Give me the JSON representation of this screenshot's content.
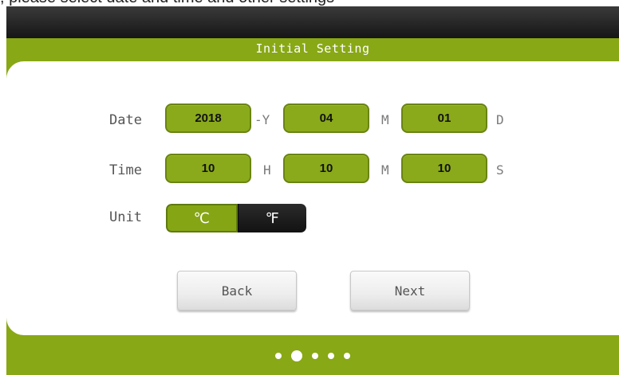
{
  "header": {
    "caption": ", please select date and time and other settings",
    "title": "Initial Setting"
  },
  "form": {
    "date": {
      "label": "Date",
      "year": {
        "value": "2018",
        "unit": "-Y"
      },
      "month": {
        "value": "04",
        "unit": "M"
      },
      "day": {
        "value": "01",
        "unit": "D"
      }
    },
    "time": {
      "label": "Time",
      "hour": {
        "value": "10",
        "unit": "H"
      },
      "minute": {
        "value": "10",
        "unit": "M"
      },
      "second": {
        "value": "10",
        "unit": "S"
      }
    },
    "unit": {
      "label": "Unit",
      "options": [
        "℃",
        "℉"
      ],
      "selected": "℃"
    }
  },
  "buttons": {
    "back": "Back",
    "next": "Next"
  },
  "pagination": {
    "count": 5,
    "active_index": 1
  },
  "colors": {
    "accent": "#88a815",
    "dark": "#161616"
  }
}
